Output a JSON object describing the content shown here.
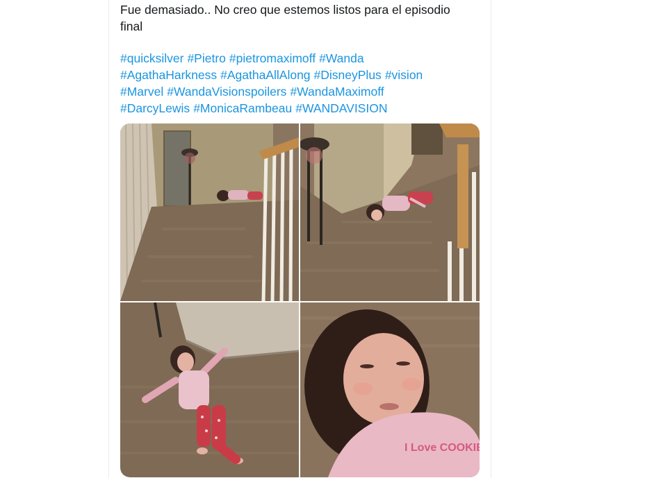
{
  "tweet": {
    "text_lines": [
      "Fue demasiado.. No creo que estemos listos para el episodio",
      "final"
    ],
    "hashtag_rows": [
      [
        "#quicksilver",
        "#Pietro",
        "#pietromaximoff",
        "#Wanda"
      ],
      [
        "#AgathaHarkness",
        "#AgathaAllAlong",
        "#DisneyPlus",
        "#vision"
      ],
      [
        "#Marvel",
        "#WandaVisionspoilers",
        "#WandaMaximoff"
      ],
      [
        "#DarcyLewis",
        "#MonicaRambeau",
        "#WANDAVISION"
      ]
    ],
    "link_color": "#1b95e0",
    "text_color": "#14171a"
  },
  "media": {
    "photos": [
      {
        "name": "photo-girl-on-floor-wide"
      },
      {
        "name": "photo-girl-on-floor-by-stairs"
      },
      {
        "name": "photo-girl-on-floor-closeup"
      },
      {
        "name": "photo-girl-face-closeup"
      }
    ],
    "shirt_text": "I Love COOKIES"
  }
}
